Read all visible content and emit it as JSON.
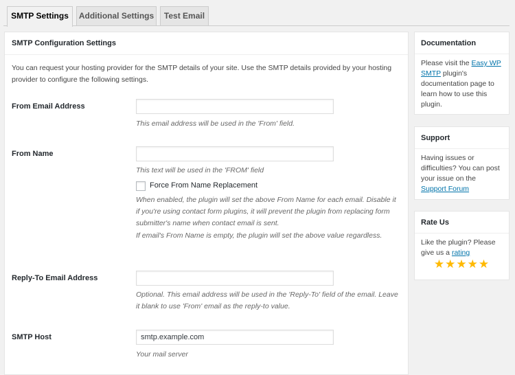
{
  "tabs": [
    {
      "label": "SMTP Settings",
      "active": true
    },
    {
      "label": "Additional Settings",
      "active": false
    },
    {
      "label": "Test Email",
      "active": false
    }
  ],
  "main": {
    "title": "SMTP Configuration Settings",
    "intro": "You can request your hosting provider for the SMTP details of your site. Use the SMTP details provided by your hosting provider to configure the following settings.",
    "from_email": {
      "label": "From Email Address",
      "value": "",
      "desc": "This email address will be used in the 'From' field."
    },
    "from_name": {
      "label": "From Name",
      "value": "",
      "desc": "This text will be used in the 'FROM' field",
      "force_label": "Force From Name Replacement",
      "force_checked": false,
      "force_desc": "When enabled, the plugin will set the above From Name for each email. Disable it if you're using contact form plugins, it will prevent the plugin from replacing form submitter's name when contact email is sent.",
      "force_desc2": "If email's From Name is empty, the plugin will set the above value regardless."
    },
    "reply_to": {
      "label": "Reply-To Email Address",
      "value": "",
      "desc": "Optional. This email address will be used in the 'Reply-To' field of the email. Leave it blank to use 'From' email as the reply-to value."
    },
    "smtp_host": {
      "label": "SMTP Host",
      "value": "smtp.example.com",
      "desc": "Your mail server"
    }
  },
  "sidebar": {
    "documentation": {
      "title": "Documentation",
      "text_before": "Please visit the ",
      "link": "Easy WP SMTP",
      "text_after": " plugin's documentation page to learn how to use this plugin."
    },
    "support": {
      "title": "Support",
      "text_before": "Having issues or difficulties? You can post your issue on the ",
      "link": "Support Forum"
    },
    "rate": {
      "title": "Rate Us",
      "text_before": "Like the plugin? Please give us a ",
      "link": "rating",
      "stars": 5
    }
  },
  "colors": {
    "link": "#0073aa",
    "star": "#ffb900"
  }
}
